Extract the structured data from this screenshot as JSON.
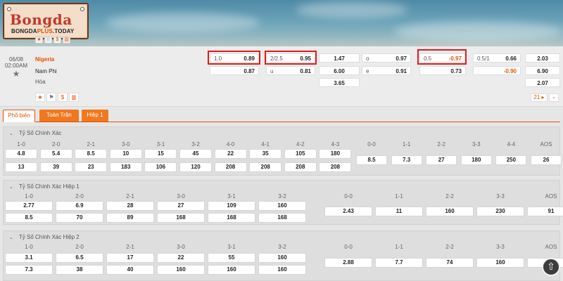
{
  "brand": {
    "logo_main": "Bongda",
    "logo_sub_a": "BONGDA",
    "logo_sub_b": "PLUS",
    "logo_sub_c": ".TODAY"
  },
  "match": {
    "date": "06/08",
    "time": "02:00AM",
    "home": "Nigeria",
    "away": "Nam Phi",
    "draw": "Hòa",
    "handicap_ft": {
      "line": "1.0",
      "home": "0.89",
      "away": "0.87"
    },
    "ou_ft": {
      "line": "2/2.5",
      "over": "0.95",
      "u_label": "u",
      "under": "0.81"
    },
    "x12_ft": {
      "home": "1.47",
      "away": "6.00",
      "draw": "3.65"
    },
    "oe": {
      "o_label": "o",
      "odd": "0.97",
      "e_label": "e",
      "even": "0.91"
    },
    "handicap_h1": {
      "line": "0.5",
      "home": "-0.97",
      "away": "0.73"
    },
    "ou_h1": {
      "line": "0.5/1",
      "over": "0.66",
      "under": "-0.90"
    },
    "x12_h1": {
      "home": "2.03",
      "away": "6.90",
      "draw": "2.07"
    },
    "more_count": "21"
  },
  "tabs": [
    "Phổ biến",
    "Toàn Trận",
    "Hiệp 1"
  ],
  "sections": [
    {
      "title": "Tỷ Số Chính Xác",
      "left_headers": [
        "1-0",
        "2-0",
        "2-1",
        "3-0",
        "3-1",
        "3-2",
        "4-0",
        "4-1",
        "4-2",
        "4-3"
      ],
      "row1": [
        "4.8",
        "5.4",
        "8.5",
        "10",
        "15",
        "45",
        "22",
        "35",
        "105",
        "180"
      ],
      "row2": [
        "13",
        "39",
        "23",
        "183",
        "106",
        "120",
        "208",
        "208",
        "208",
        "208"
      ],
      "right_headers": [
        "0-0",
        "1-1",
        "2-2",
        "3-3",
        "4-4",
        "AOS"
      ],
      "right_values": [
        "8.5",
        "7.3",
        "27",
        "180",
        "250",
        "26"
      ]
    },
    {
      "title": "Tỷ Số Chính Xác Hiệp 1",
      "left_headers": [
        "1-0",
        "2-0",
        "2-1",
        "3-0",
        "3-1",
        "3-2"
      ],
      "row1": [
        "2.77",
        "6.9",
        "28",
        "27",
        "109",
        "160"
      ],
      "row2": [
        "8.5",
        "70",
        "89",
        "168",
        "168",
        "168"
      ],
      "right_headers": [
        "0-0",
        "1-1",
        "2-2",
        "3-3",
        "AOS"
      ],
      "right_values": [
        "2.43",
        "11",
        "160",
        "230",
        "91"
      ]
    },
    {
      "title": "Tỷ Số Chính Xác Hiệp 2",
      "left_headers": [
        "1-0",
        "2-0",
        "2-1",
        "3-0",
        "3-1",
        "3-2"
      ],
      "row1": [
        "3.1",
        "6.5",
        "17",
        "22",
        "55",
        "160"
      ],
      "row2": [
        "7.3",
        "38",
        "40",
        "160",
        "160",
        "160"
      ],
      "right_headers": [
        "0-0",
        "1-1",
        "2-2",
        "3-3",
        "AOS"
      ],
      "right_values": [
        "2.88",
        "7.7",
        "74",
        "160",
        "48"
      ]
    }
  ]
}
